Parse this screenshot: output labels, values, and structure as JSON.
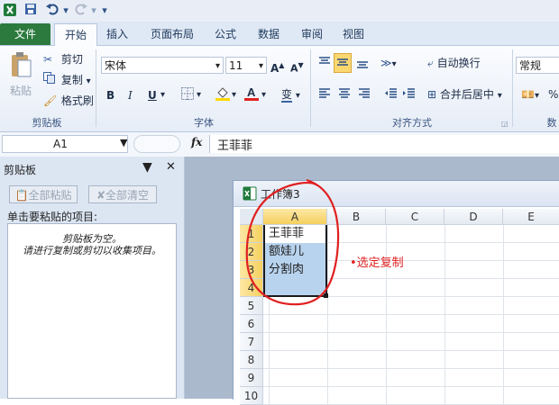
{
  "quick_access": {
    "dropdown_glyph": "▾"
  },
  "tabs": [
    {
      "label": "文件"
    },
    {
      "label": "开始"
    },
    {
      "label": "插入"
    },
    {
      "label": "页面布局"
    },
    {
      "label": "公式"
    },
    {
      "label": "数据"
    },
    {
      "label": "审阅"
    },
    {
      "label": "视图"
    }
  ],
  "ribbon": {
    "clipboard": {
      "paste": "粘贴",
      "cut": "剪切",
      "copy": "复制",
      "format_painter": "格式刷",
      "group_label": "剪贴板"
    },
    "font": {
      "name": "宋体",
      "size": "11",
      "bold": "B",
      "italic": "I",
      "underline": "U",
      "grow": "A",
      "shrink": "A",
      "phonetic": "变",
      "group_label": "字体"
    },
    "alignment": {
      "wrap_text": "自动换行",
      "merge_center": "合并后居中",
      "group_label": "对齐方式"
    },
    "number": {
      "format": "常规",
      "percent": "%",
      "group_label": "数"
    }
  },
  "formula_bar": {
    "name_box": "A1",
    "fx": "fx",
    "content": "王菲菲"
  },
  "clipboard_pane": {
    "title": "剪贴板",
    "paste_all": "全部粘贴",
    "clear_all": "全部清空",
    "instruction": "单击要粘贴的项目:",
    "empty_line1": "剪贴板为空。",
    "empty_line2": "请进行复制或剪切以收集项目。"
  },
  "workbook": {
    "title": "工作簿3",
    "columns": [
      "A",
      "B",
      "C",
      "D",
      "E"
    ],
    "rows": [
      "1",
      "2",
      "3",
      "4",
      "5",
      "6",
      "7",
      "8",
      "9",
      "10"
    ],
    "cells": {
      "a1": "王菲菲",
      "a2": "额娃儿",
      "a3": "分割肉"
    }
  },
  "annotation": {
    "text": "•选定复制",
    "color": "#e02020"
  },
  "colors": {
    "file_tab": "#2c7a3e",
    "selection": "#b8d3ee",
    "row_highlight": "#f5d66b",
    "accent": "#2a4f86"
  }
}
